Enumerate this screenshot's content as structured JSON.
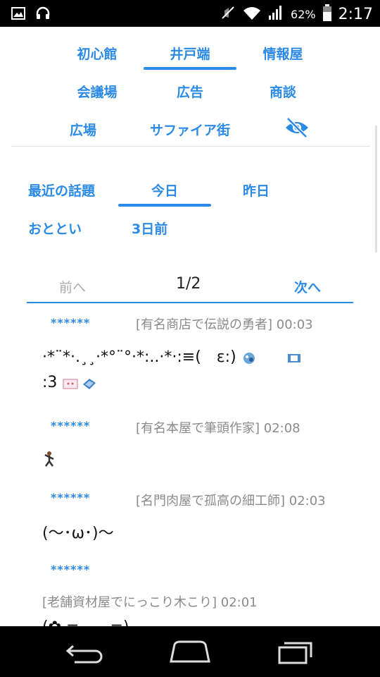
{
  "status": {
    "battery": "62%",
    "time": "2:17"
  },
  "tabs": [
    {
      "label": "初心館"
    },
    {
      "label": "井戸端"
    },
    {
      "label": "情報屋"
    },
    {
      "label": "会議場"
    },
    {
      "label": "広告"
    },
    {
      "label": "商談"
    },
    {
      "label": "広場"
    },
    {
      "label": "サファイア街"
    }
  ],
  "subtabs": [
    {
      "label": "最近の話題"
    },
    {
      "label": "今日"
    },
    {
      "label": "昨日"
    },
    {
      "label": "おととい"
    },
    {
      "label": "3日前"
    }
  ],
  "pager": {
    "prev": "前へ",
    "page": "1/2",
    "next": "次へ"
  },
  "posts": [
    {
      "stars": "******",
      "meta": "[有名商店で伝説の勇者] 00:03",
      "line1": "·*¨*·.¸¸·*°¨°·*:..·*·:≡(　ε:)",
      "line2": ":3"
    },
    {
      "stars": "******",
      "meta": "[有名本屋で筆頭作家] 02:08"
    },
    {
      "stars": "******",
      "meta": "[名門肉屋で孤高の細工師] 02:03",
      "line1": "(〜･ω･)〜"
    },
    {
      "stars": "******",
      "meta": "[老舗資材屋でにっこり木こり] 02:01",
      "line1": "(✿ =　　=)"
    }
  ],
  "colors": {
    "accent": "#2b8ae6",
    "status_bar": "#000000"
  }
}
